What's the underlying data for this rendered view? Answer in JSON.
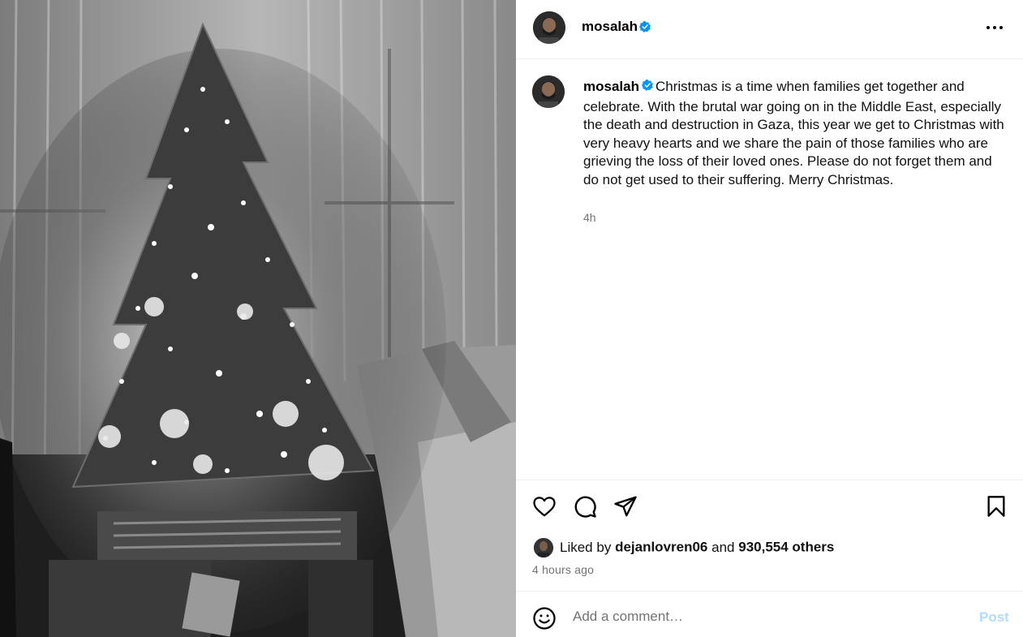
{
  "post": {
    "image_alt": "",
    "author": {
      "username": "mosalah",
      "verified": true
    }
  },
  "header": {
    "username": "mosalah",
    "more_icon": "more-horizontal-icon"
  },
  "caption": {
    "username": "mosalah",
    "text": "Christmas is a time when families get together and celebrate. With the brutal war going on in the Middle East, especially the death and destruction in Gaza, this year we get to Christmas with very heavy hearts and we share the pain of those families who are grieving the loss of their loved ones. Please do not forget them and do not get used to their suffering. Merry Christmas.",
    "relative_time": "4h"
  },
  "actions": {
    "like_icon": "heart-icon",
    "comment_icon": "comment-bubble-icon",
    "share_icon": "paper-plane-icon",
    "save_icon": "bookmark-icon"
  },
  "likes": {
    "prefix": "Liked by",
    "liker": "dejanlovren06",
    "conjunction": "and",
    "count_text": "930,554 others"
  },
  "posted_ago": "4 hours ago",
  "comment_box": {
    "emoji_icon": "smiley-icon",
    "placeholder": "Add a comment…",
    "post_label": "Post"
  },
  "colors": {
    "verified_blue": "#0095f6",
    "post_button_disabled": "#b3dbff",
    "secondary_text": "#737373",
    "divider": "#efefef"
  }
}
